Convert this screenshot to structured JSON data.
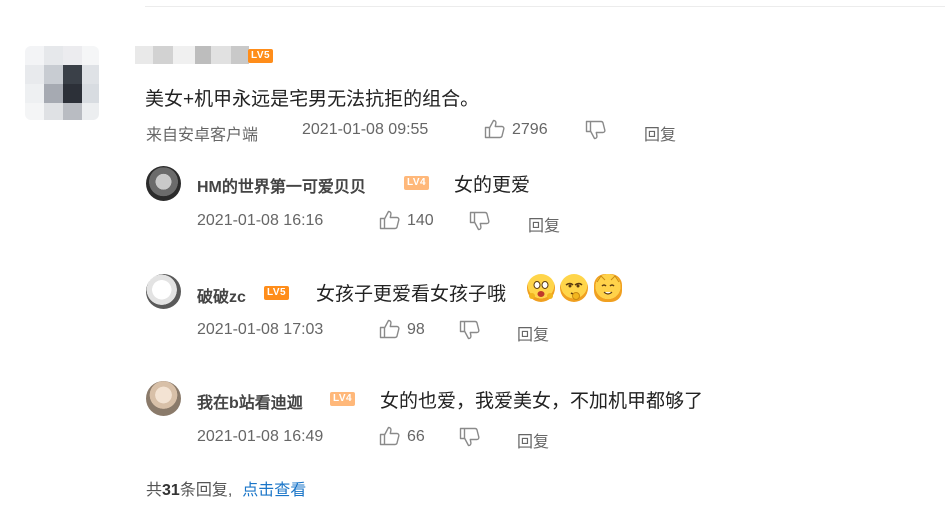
{
  "main": {
    "level": "LV5",
    "text": "美女+机甲永远是宅男无法抗拒的组合。",
    "source": "来自安卓客户端",
    "time": "2021-01-08 09:55",
    "likes": "2796",
    "reply": "回复"
  },
  "replies": [
    {
      "user": "HM的世界第一可爱贝贝",
      "level": "LV4",
      "text": "女的更爱",
      "time": "2021-01-08 16:16",
      "likes": "140",
      "reply": "回复"
    },
    {
      "user": "破破zc",
      "level": "LV5",
      "text": "女孩子更爱看女孩子哦",
      "time": "2021-01-08 17:03",
      "likes": "98",
      "reply": "回复"
    },
    {
      "user": "我在b站看迪迦",
      "level": "LV4",
      "text": "女的也爱，我爱美女，不加机甲都够了",
      "time": "2021-01-08 16:49",
      "likes": "66",
      "reply": "回复"
    }
  ],
  "footer": {
    "prefix": "共",
    "count": "31",
    "suffix": "条回复,",
    "link": "点击查看"
  },
  "icons": {
    "like": "thumbs-up-icon",
    "dislike": "thumbs-down-icon"
  },
  "colors": {
    "level5": "#ff8d1a",
    "level4": "#ffb87a",
    "link": "#1a75c8"
  }
}
